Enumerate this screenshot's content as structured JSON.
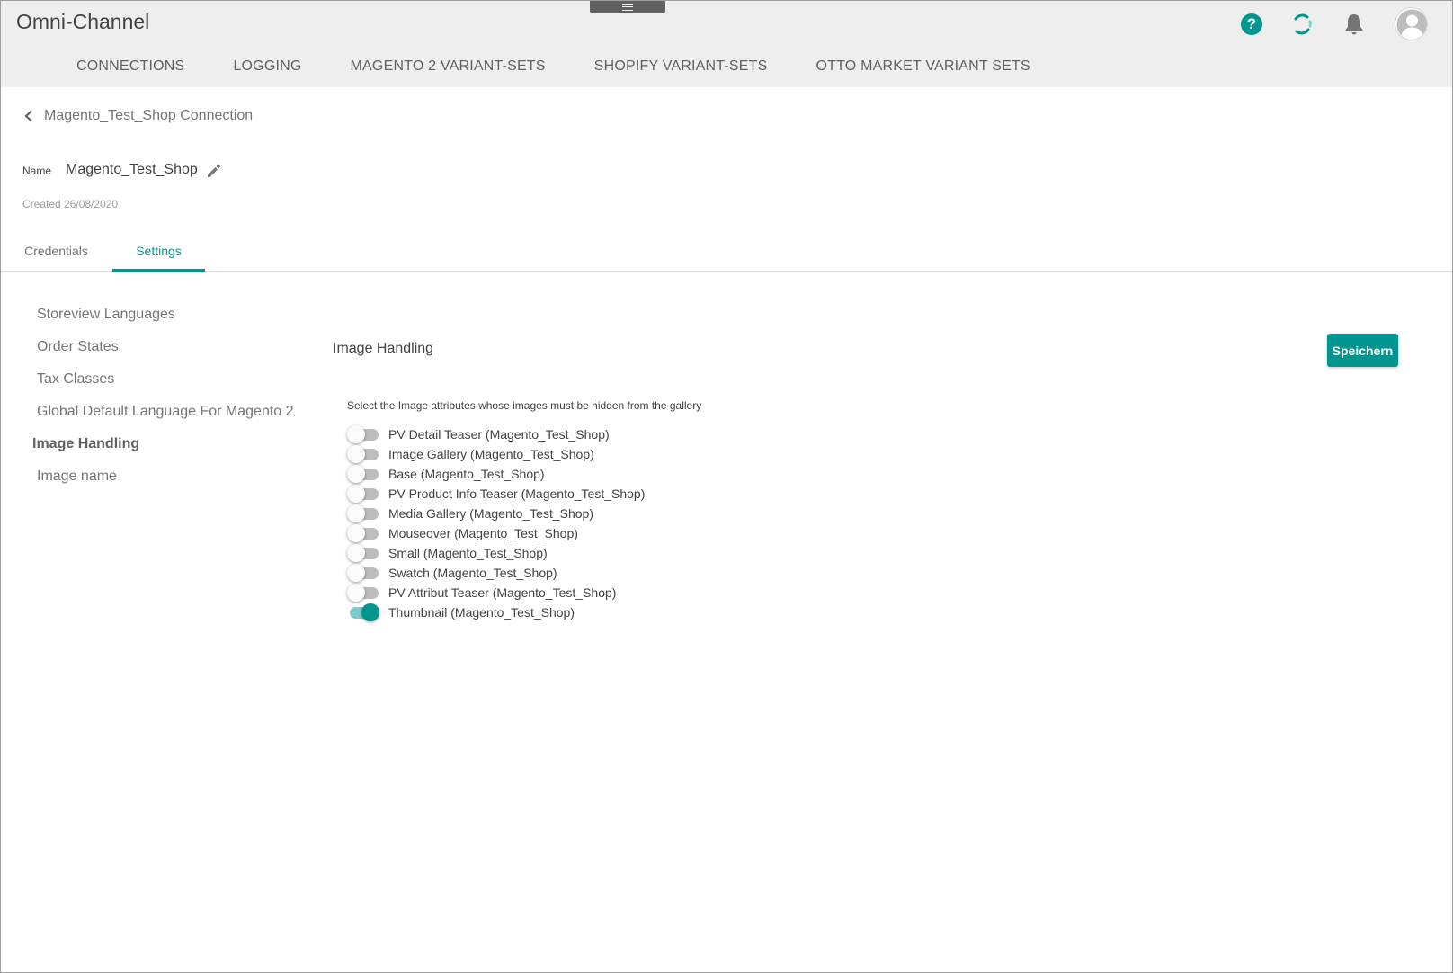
{
  "app": {
    "title": "Omni-Channel"
  },
  "header": {
    "icons": [
      "help-icon",
      "sync-icon",
      "bell-icon",
      "avatar"
    ],
    "tabs": [
      {
        "label": "CONNECTIONS",
        "active": true
      },
      {
        "label": "LOGGING",
        "active": false
      },
      {
        "label": "MAGENTO 2 VARIANT-SETS",
        "active": false
      },
      {
        "label": "SHOPIFY VARIANT-SETS",
        "active": false
      },
      {
        "label": "OTTO MARKET VARIANT SETS",
        "active": false
      }
    ]
  },
  "page": {
    "breadcrumb": "Magento_Test_Shop Connection",
    "name_label": "Name",
    "name_value": "Magento_Test_Shop",
    "created": "Created 26/08/2020",
    "sub_tabs": [
      {
        "label": "Credentials",
        "active": false
      },
      {
        "label": "Settings",
        "active": true
      }
    ]
  },
  "side_nav": {
    "items": [
      {
        "label": "Storeview Languages",
        "active": false
      },
      {
        "label": "Order States",
        "active": false
      },
      {
        "label": "Tax Classes",
        "active": false
      },
      {
        "label": "Global Default Language For Magento 2",
        "active": false
      },
      {
        "label": "Image Handling",
        "active": true
      },
      {
        "label": "Image name",
        "active": false
      }
    ]
  },
  "content": {
    "title": "Image Handling",
    "save_label": "Speichern",
    "instruction": "Select the Image attributes whose images must be hidden from the gallery",
    "toggles": [
      {
        "label": "PV Detail Teaser (Magento_Test_Shop)",
        "checked": false
      },
      {
        "label": "Image Gallery (Magento_Test_Shop)",
        "checked": false
      },
      {
        "label": "Base (Magento_Test_Shop)",
        "checked": false
      },
      {
        "label": "PV Product Info Teaser (Magento_Test_Shop)",
        "checked": false
      },
      {
        "label": "Media Gallery (Magento_Test_Shop)",
        "checked": false
      },
      {
        "label": "Mouseover (Magento_Test_Shop)",
        "checked": false
      },
      {
        "label": "Small (Magento_Test_Shop)",
        "checked": false
      },
      {
        "label": "Swatch (Magento_Test_Shop)",
        "checked": false
      },
      {
        "label": "PV Attribut Teaser (Magento_Test_Shop)",
        "checked": false
      },
      {
        "label": "Thumbnail (Magento_Test_Shop)",
        "checked": true
      }
    ]
  },
  "colors": {
    "accent": "#00968f",
    "header_bg": "#eeeeee",
    "text": "#424242",
    "muted": "#757575"
  }
}
